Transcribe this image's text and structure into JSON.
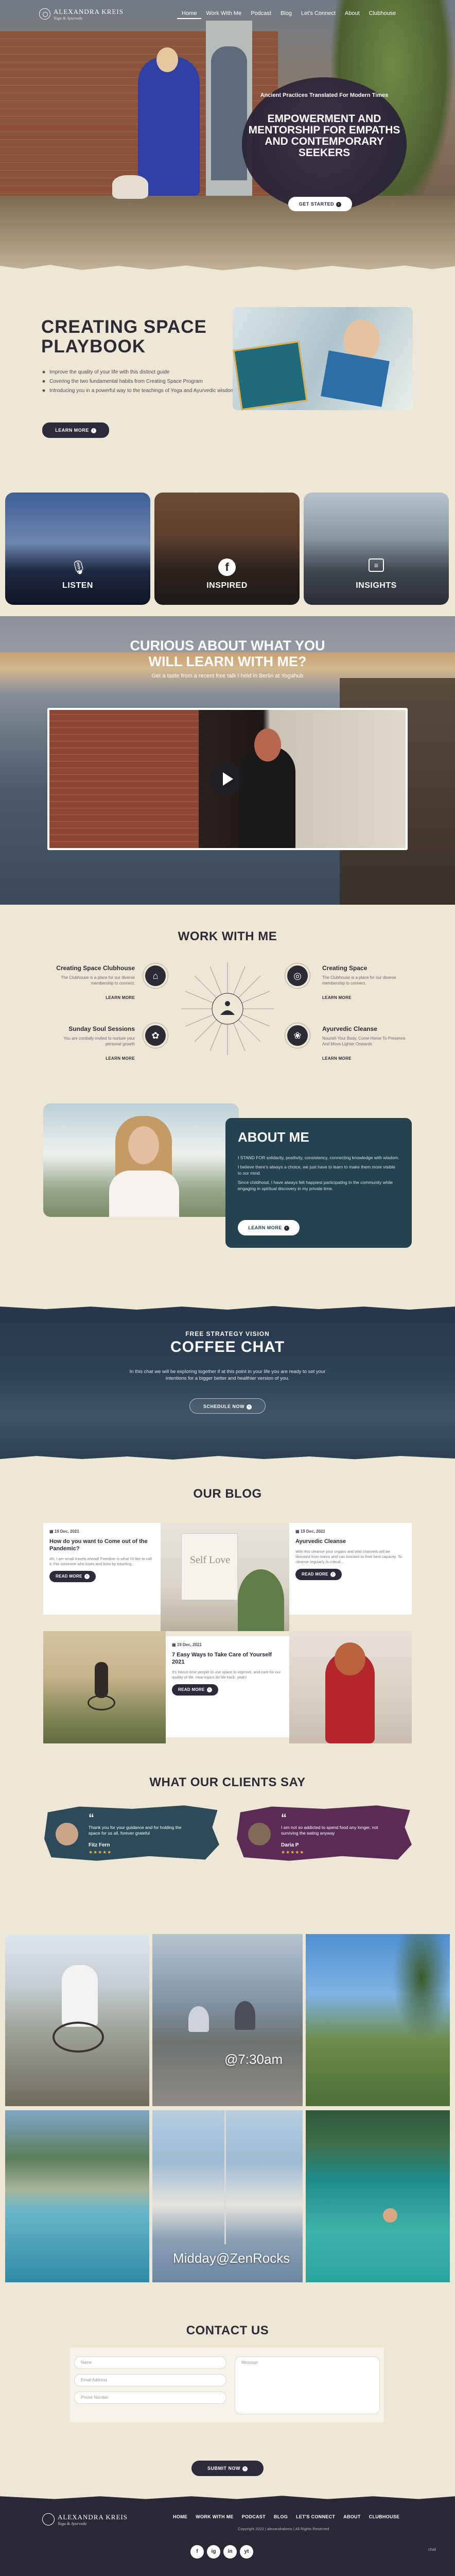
{
  "nav": {
    "logo_name": "ALEXANDRA KREIS",
    "logo_tagline": "Yoga & Ayurveda",
    "items": [
      "Home",
      "Work With Me",
      "Podcast",
      "Blog",
      "Let's Connect",
      "About",
      "Clubhouse"
    ]
  },
  "hero": {
    "subtitle": "Ancient Practices Translated For Modern Times",
    "title": "EMPOWERMENT AND MENTORSHIP FOR EMPATHS AND CONTEMPORARY SEEKERS",
    "cta": "GET STARTED"
  },
  "playbook": {
    "title_line1": "CREATING SPACE",
    "title_line2": "PLAYBOOK",
    "bullets": [
      "Improve the quality of your life with this distinct guide",
      "Covering the two fundamental habits from Creating Space Program",
      "Introducing you in a powerful way to the teachings of Yoga and Ayurvedic wisdom"
    ],
    "cta": "LEARN MORE"
  },
  "cards": [
    {
      "label": "LISTEN",
      "icon": "microphone-icon"
    },
    {
      "label": "INSPIRED",
      "icon": "facebook-icon"
    },
    {
      "label": "INSIGHTS",
      "icon": "news-icon"
    }
  ],
  "curious": {
    "title": "CURIOUS ABOUT WHAT YOU WILL LEARN WITH ME?",
    "subtitle": "Get a taste from a recent free talk I held in Berlin at Yogahub"
  },
  "work": {
    "heading": "WORK WITH ME",
    "services": [
      {
        "title": "Creating Space Clubhouse",
        "text": "The Clubhouse is a place for our diverse membership to connect.",
        "link": "LEARN MORE",
        "icon": "clubhouse-icon"
      },
      {
        "title": "Creating Space",
        "text": "The Clubhouse is a place for our diverse membership to connect.",
        "link": "LEARN MORE",
        "icon": "creating-space-icon"
      },
      {
        "title": "Sunday Soul Sessions",
        "text": "You are cordially invited to nurture your personal growth",
        "link": "LEARN MORE",
        "icon": "soul-sessions-icon"
      },
      {
        "title": "Ayurvedic Cleanse",
        "text": "Nourish Your Body, Come Home To Presence And Move Lighter Onwards",
        "link": "LEARN MORE",
        "icon": "cleanse-icon"
      }
    ]
  },
  "about": {
    "title": "ABOUT ME",
    "paragraphs": [
      "I STAND FOR solidarity, positivity, consistency, connecting knowledge with wisdom.",
      "I believe there's always a choice, we just have to learn to make them more visible to our mind.",
      "Since childhood, I have always felt happiest participating in the community while engaging in spiritual discovery in my private time."
    ],
    "cta": "LEARN MORE"
  },
  "coffee": {
    "kicker": "FREE STRATEGY VISION",
    "title": "COFFEE CHAT",
    "text": "In this chat we will be exploring together if at this point in your life you are ready to set your intentions for a bigger better and healthier version of you.",
    "cta": "SCHEDULE NOW"
  },
  "blog": {
    "heading": "OUR BLOG",
    "posts": [
      {
        "date": "19 Dec, 2021",
        "title": "How do you want to Come out of the Pandemic?",
        "excerpt": "Ah, I am small travels ahead! Freedom is what I'd like to call it. For someone who loves and lives by traveling...",
        "cta": "READ MORE"
      },
      {
        "date": "19 Dec, 2021",
        "title": "Ayurvedic Cleanse",
        "excerpt": "With this cleanse your organs and vital channels will be liberated from toxins and can function to their best capacity. To cleanse regularly is critical...",
        "cta": "READ MORE"
      },
      {
        "date": "19 Dec, 2021",
        "title": "7 Easy Ways to Take Care of Yourself 2021",
        "excerpt": "It's hence time people to use space to improve, and care for our quality of life. How topics do life hack. yeah!",
        "cta": "READ MORE"
      }
    ],
    "self_love_text": "Self Love"
  },
  "clients": {
    "heading": "WHAT OUR CLIENTS SAY",
    "testimonials": [
      {
        "quote": "Thank you for your guidance and for holding the space for us all, forever grateful",
        "name": "Fitz Fern",
        "stars": "★★★★★",
        "color": "#2c4a57"
      },
      {
        "quote": "I am not so addicted to spend food any longer, not surviving the eating anyway",
        "name": "Daria P",
        "stars": "★★★★★",
        "color": "#5a2c55"
      }
    ]
  },
  "gallery": {
    "captions": [
      "@7:30am",
      "Midday@ZenRocks"
    ]
  },
  "contact": {
    "heading": "CONTACT US",
    "name_placeholder": "Name",
    "email_placeholder": "Email Address",
    "phone_placeholder": "Phone Number",
    "message_placeholder": "Message",
    "cta": "SUBMIT NOW"
  },
  "footer": {
    "logo_name": "ALEXANDRA KREIS",
    "logo_tagline": "Yoga & Ayurveda",
    "items": [
      "HOME",
      "WORK WITH ME",
      "PODCAST",
      "BLOG",
      "LET'S CONNECT",
      "ABOUT",
      "CLUBHOUSE"
    ],
    "copyright": "Copyright 2022 | alexandrakreis | All Rights Reserved",
    "social": [
      "f",
      "ig",
      "in",
      "yt"
    ],
    "chat": "chat"
  },
  "colors": {
    "background": "#efe7d6",
    "dark": "#2c2b3c",
    "about_card": "#24424f",
    "star": "#f4b740"
  }
}
